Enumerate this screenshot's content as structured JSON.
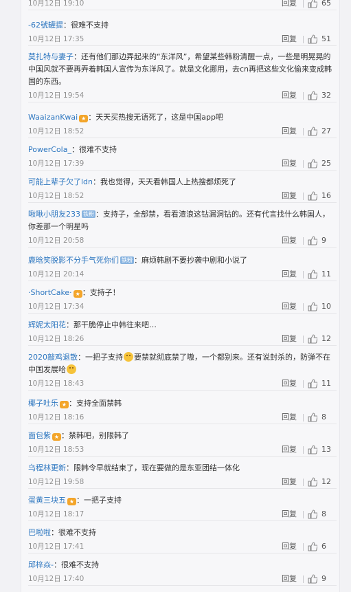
{
  "reply_label": "回复",
  "comments": [
    {
      "user": "",
      "text": "",
      "time": "10月12日 19:10",
      "likes": "65"
    },
    {
      "user": "-62號罐提",
      "text": "很难不支持",
      "time": "10月12日 17:35",
      "likes": "51"
    },
    {
      "user": "莫扎特与妻子",
      "text": "还有他们那边弄起来的“东洋风”，希望某些韩粉清醒一点，一些是明晃晃的中国风就不要再弄着韩国人宣传为东洋风了。就是文化挪用，去cn再把这些文化偷来变成韩国的东西。",
      "time": "10月12日 19:54",
      "likes": "32"
    },
    {
      "user": "WaaizanKwai",
      "text": "天天买热搜无语死了，这是中国app吧",
      "time": "10月12日 18:52",
      "likes": "27",
      "vip": true
    },
    {
      "user": "PowerCola_",
      "text": "很难不支持",
      "time": "10月12日 17:39",
      "likes": "25"
    },
    {
      "user": "可能上辈子欠了ldn",
      "text": "我也觉得，天天看韩国人上热搜都烦死了",
      "time": "10月12日 18:52",
      "likes": "16"
    },
    {
      "user": "啾啾小朋友233",
      "badge": "铁粉",
      "text": "支持子，全部禁，看看渣浪这钻漏洞钻的。还有代言找什么韩国人，你差那一个明星吗",
      "time": "10月12日 20:58",
      "likes": "9"
    },
    {
      "user": "鹿晗笑脱影不分手气死你们",
      "badge": "铁粉",
      "text": "麻烦韩剧不要抄袭中剧和小说了",
      "time": "10月12日 20:14",
      "likes": "11"
    },
    {
      "user": "·ShortCake·",
      "text": "支持子！",
      "time": "10月12日 17:34",
      "likes": "10",
      "vip": true
    },
    {
      "user": "辉妮太阳花",
      "text": "那干脆停止中韩往来吧…",
      "time": "10月12日 18:26",
      "likes": "12"
    },
    {
      "user": "2020敲鸡退散",
      "text": "一把子支持",
      "text2": "要禁就彻底禁了嗷，一个都别来。还有说封杀的，防弹不在中国发展哈",
      "time": "10月12日 18:43",
      "likes": "11"
    },
    {
      "user": "椰子吐乐",
      "text": "支持全面禁韩",
      "time": "10月12日 18:16",
      "likes": "8",
      "vip": true
    },
    {
      "user": "面包紫",
      "text": "禁韩吧，别限韩了",
      "time": "10月12日 18:53",
      "likes": "13",
      "vip": true
    },
    {
      "user": "乌程林更新",
      "text": "限韩令早就结束了，现在要做的是东亚团结一体化",
      "time": "10月12日 19:58",
      "likes": "12"
    },
    {
      "user": "蛋黄三块五",
      "text": "一把子支持",
      "time": "10月12日 18:17",
      "likes": "8",
      "vip": true
    },
    {
      "user": "巴啦啦",
      "text": "很难不支持",
      "time": "10月12日 17:41",
      "likes": "6"
    },
    {
      "user": "邱梓焱-",
      "text": "很难不支持",
      "time": "10月12日 17:40",
      "likes": "9"
    }
  ]
}
